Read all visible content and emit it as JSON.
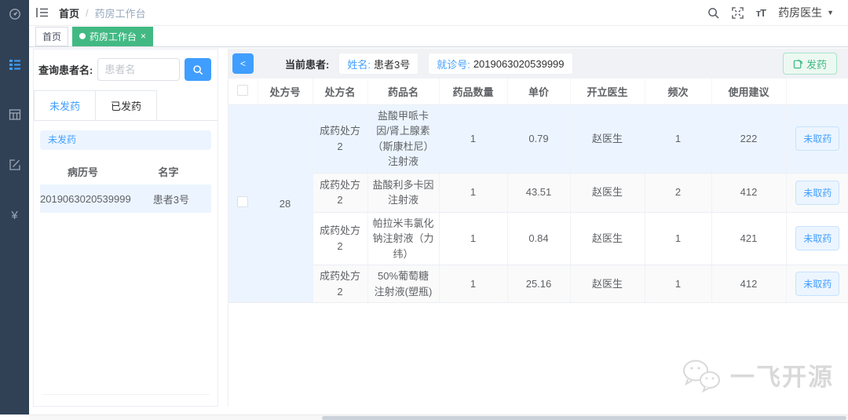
{
  "sidebar": {
    "icons": [
      {
        "name": "dashboard-icon",
        "active": false
      },
      {
        "name": "list-icon",
        "active": true
      },
      {
        "name": "grid-icon",
        "active": false
      },
      {
        "name": "edit-icon",
        "active": false
      },
      {
        "name": "currency-icon",
        "active": false,
        "glyph": "¥"
      }
    ]
  },
  "topbar": {
    "breadcrumb": {
      "home": "首页",
      "separator": "/",
      "current": "药房工作台"
    },
    "user_menu": {
      "label": "药房医生",
      "caret": "▼"
    }
  },
  "tags": {
    "home": "首页",
    "active_tag": {
      "label": "药房工作台",
      "close": "×"
    }
  },
  "left_panel": {
    "search_label": "查询患者名:",
    "search_placeholder": "患者名",
    "search_value": "",
    "tabs": [
      {
        "label": "未发药",
        "active": true
      },
      {
        "label": "已发药",
        "active": false
      }
    ],
    "banner": "未发药",
    "list": {
      "headers": [
        "病历号",
        "名字"
      ],
      "rows": [
        {
          "record_no": "2019063020539999",
          "name": "患者3号"
        }
      ]
    }
  },
  "main": {
    "back_button": "<",
    "patient_bar": {
      "current_label": "当前患者:",
      "name_label": "姓名:",
      "name_value": "患者3号",
      "visit_label": "就诊号:",
      "visit_value": "2019063020539999",
      "dispense_label": "发药"
    },
    "table": {
      "headers": [
        "处方号",
        "处方名",
        "药品名",
        "药品数量",
        "单价",
        "开立医生",
        "频次",
        "使用建议"
      ],
      "prescription_no": "28",
      "rows": [
        {
          "prescription_name": "成药处方2",
          "drug_name": "盐酸甲哌卡因/肾上腺素（斯康杜尼）注射液",
          "quantity": "1",
          "unit_price": "0.79",
          "doctor": "赵医生",
          "frequency": "1",
          "advice": "222",
          "action": "未取药"
        },
        {
          "prescription_name": "成药处方2",
          "drug_name": "盐酸利多卡因注射液",
          "quantity": "1",
          "unit_price": "43.51",
          "doctor": "赵医生",
          "frequency": "2",
          "advice": "412",
          "action": "未取药"
        },
        {
          "prescription_name": "成药处方2",
          "drug_name": "帕拉米韦氯化钠注射液（力纬）",
          "quantity": "1",
          "unit_price": "0.84",
          "doctor": "赵医生",
          "frequency": "1",
          "advice": "421",
          "action": "未取药"
        },
        {
          "prescription_name": "成药处方2",
          "drug_name": "50%葡萄糖注射液(塑瓶)",
          "quantity": "1",
          "unit_price": "25.16",
          "doctor": "赵医生",
          "frequency": "1",
          "advice": "412",
          "action": "未取药"
        }
      ]
    }
  },
  "watermark": {
    "text": "一飞开源"
  },
  "colors": {
    "accent_blue": "#409eff",
    "success_green": "#42b983",
    "sidebar_bg": "#304156",
    "row_highlight": "#ecf5ff",
    "stripe": "#fafafa",
    "bar_bg": "#f0f2f5"
  }
}
